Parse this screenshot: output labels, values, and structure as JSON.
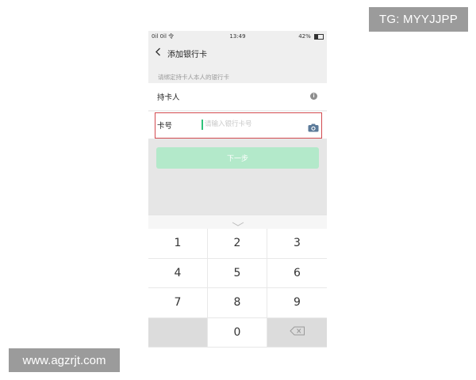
{
  "watermarks": {
    "tg": "TG: MYYJJPP",
    "site": "www.agzrjt.com"
  },
  "status_bar": {
    "signal": "0il 0il 令",
    "time": "13:49",
    "battery": "42%"
  },
  "nav": {
    "title": "添加银行卡"
  },
  "form": {
    "hint": "请绑定持卡人本人的银行卡",
    "holder_label": "持卡人",
    "card_label": "卡号",
    "card_placeholder": "请输入银行卡号",
    "next_label": "下一步"
  },
  "keypad": {
    "keys": [
      "1",
      "2",
      "3",
      "4",
      "5",
      "6",
      "7",
      "8",
      "9",
      "",
      "0",
      ""
    ]
  },
  "colors": {
    "accent_green": "#2fc27a",
    "button_disabled": "#b3e9ca",
    "highlight_border": "#d24a4f"
  }
}
